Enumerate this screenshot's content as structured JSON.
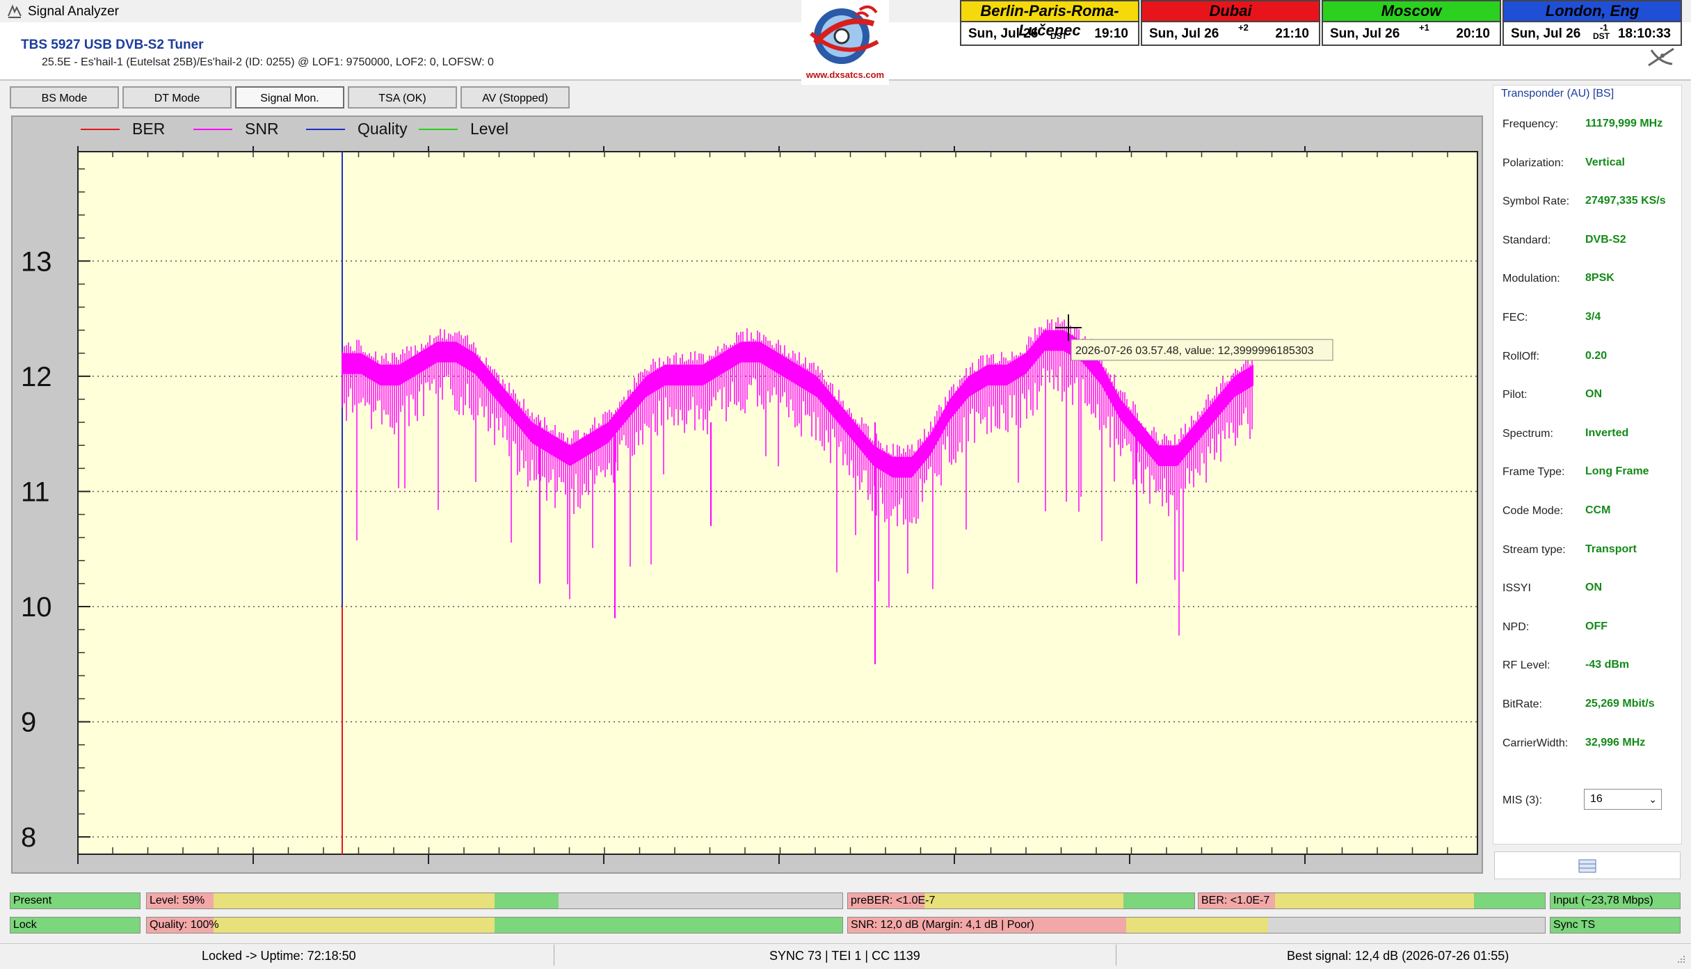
{
  "window": {
    "title": "Signal Analyzer"
  },
  "header": {
    "device_name": "TBS 5927 USB DVB-S2 Tuner",
    "device_sub": "25.5E - Es'hail-1 (Eutelsat 25B)/Es'hail-2 (ID: 0255) @ LOF1: 9750000, LOF2: 0, LOFSW: 0",
    "logo_url": "www.dxsatcs.com"
  },
  "clocks": [
    {
      "city": "Berlin-Paris-Roma-Lučenec",
      "date": "Sun, Jul 26",
      "dst": "DST",
      "offset": "",
      "time": "19:10",
      "color": "#f5d90a"
    },
    {
      "city": "Dubai",
      "date": "Sun, Jul 26",
      "dst": "",
      "offset": "+2",
      "time": "21:10",
      "color": "#e8141c"
    },
    {
      "city": "Moscow",
      "date": "Sun, Jul 26",
      "dst": "",
      "offset": "+1",
      "time": "20:10",
      "color": "#2bd11e"
    },
    {
      "city": "London, Eng",
      "date": "Sun, Jul 26",
      "dst": "DST",
      "offset": "-1",
      "time": "18:10:33",
      "color": "#1f4fd6"
    }
  ],
  "tabs": [
    {
      "label": "BS Mode"
    },
    {
      "label": "DT Mode"
    },
    {
      "label": "Signal Mon."
    },
    {
      "label": "TSA (OK)"
    },
    {
      "label": "AV (Stopped)"
    }
  ],
  "chart_data": {
    "type": "line",
    "title": "",
    "xlabel": "",
    "ylabel": "",
    "ylim": [
      7.85,
      13.95
    ],
    "yticks": [
      "8",
      "9",
      "10",
      "11",
      "12",
      "13"
    ],
    "grid": "horizontal dotted",
    "legend_position": "top-left",
    "legend": [
      {
        "name": "BER",
        "color": "#e8141c"
      },
      {
        "name": "SNR",
        "color": "#ff00ff"
      },
      {
        "name": "Quality",
        "color": "#1f2fc8"
      },
      {
        "name": "Level",
        "color": "#2bd11e"
      }
    ],
    "series": [
      {
        "name": "SNR",
        "color": "#ff00ff",
        "description_values": "upper envelope samples",
        "values": [
          12.2,
          12.2,
          12.1,
          12.1,
          12.2,
          12.3,
          12.3,
          12.2,
          12.0,
          11.8,
          11.6,
          11.5,
          11.4,
          11.5,
          11.6,
          11.8,
          12.0,
          12.1,
          12.1,
          12.1,
          12.2,
          12.3,
          12.3,
          12.2,
          12.1,
          12.0,
          11.8,
          11.6,
          11.4,
          11.3,
          11.3,
          11.5,
          11.8,
          12.0,
          12.1,
          12.1,
          12.2,
          12.4,
          12.4,
          12.3,
          12.1,
          11.8,
          11.6,
          11.4,
          11.4,
          11.6,
          11.8,
          12.0,
          12.1
        ]
      }
    ],
    "tooltip": "2026-07-26 03.57.48, value: 12,3999996185303"
  },
  "transponder": {
    "title": "Transponder (AU) [BS]",
    "rows": [
      {
        "label": "Frequency:",
        "value": "11179,999 MHz"
      },
      {
        "label": "Polarization:",
        "value": "Vertical"
      },
      {
        "label": "Symbol Rate:",
        "value": "27497,335 KS/s"
      },
      {
        "label": "Standard:",
        "value": "DVB-S2"
      },
      {
        "label": "Modulation:",
        "value": "8PSK"
      },
      {
        "label": "FEC:",
        "value": "3/4"
      },
      {
        "label": "RollOff:",
        "value": "0.20"
      },
      {
        "label": "Pilot:",
        "value": "ON"
      },
      {
        "label": "Spectrum:",
        "value": "Inverted"
      },
      {
        "label": "Frame Type:",
        "value": "Long Frame"
      },
      {
        "label": "Code Mode:",
        "value": "CCM"
      },
      {
        "label": "Stream type:",
        "value": "Transport"
      },
      {
        "label": "ISSYI",
        "value": "ON"
      },
      {
        "label": "NPD:",
        "value": "OFF"
      },
      {
        "label": "RF Level:",
        "value": "-43 dBm"
      },
      {
        "label": "BitRate:",
        "value": "25,269 Mbit/s"
      },
      {
        "label": "CarrierWidth:",
        "value": "32,996 MHz"
      }
    ],
    "mis_label": "MIS (3):",
    "mis_value": "16"
  },
  "status": {
    "present": "Present",
    "lock": "Lock",
    "level": "Level: 59%",
    "level_pct": 59,
    "quality": "Quality: 100%",
    "quality_pct": 100,
    "preber": "preBER: <1.0E-7",
    "ber": "BER: <1.0E-7",
    "snr": "SNR: 12,0 dB (Margin: 4,1 dB | Poor)",
    "input": "Input (~23,78 Mbps)",
    "sync": "Sync TS"
  },
  "footer": {
    "left": "Locked -> Uptime: 72:18:50",
    "center": "SYNC 73 | TEI 1 | CC 1139",
    "right": "Best signal: 12,4 dB (2026-07-26 01:55)"
  }
}
